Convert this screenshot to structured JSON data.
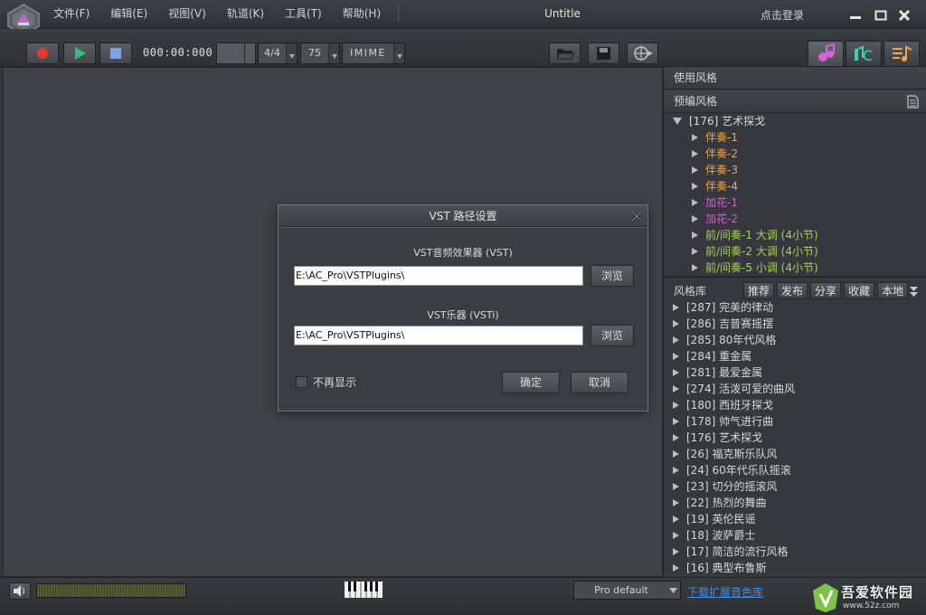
{
  "menu": [
    "文件(F)",
    "编辑(E)",
    "视图(V)",
    "轨道(K)",
    "工具(T)",
    "帮助(H)"
  ],
  "title": "Untitle",
  "login": "点击登录",
  "transport": {
    "time": "000:00:000",
    "meter": "4/4",
    "tempo": "75",
    "ime": "IMIME"
  },
  "panel": {
    "use_style": "使用风格",
    "preset_style": "预编风格",
    "preset_root": "[176] 艺术探戈",
    "preset_items": [
      {
        "label": "伴奏-1",
        "color": "#f0a64a"
      },
      {
        "label": "伴奏-2",
        "color": "#f0a64a"
      },
      {
        "label": "伴奏-3",
        "color": "#f0a64a"
      },
      {
        "label": "伴奏-4",
        "color": "#f0a64a"
      },
      {
        "label": "加花-1",
        "color": "#d959d9"
      },
      {
        "label": "加花-2",
        "color": "#d959d9"
      },
      {
        "label": "前/间奏-1 大调 (4小节)",
        "color": "#a9cf5b"
      },
      {
        "label": "前/间奏-2 大调 (4小节)",
        "color": "#a9cf5b"
      },
      {
        "label": "前/间奏-5 小调 (4小节)",
        "color": "#a9cf5b"
      }
    ],
    "library_title": "风格库",
    "library_tabs": [
      "推荐",
      "发布",
      "分享",
      "收藏",
      "本地"
    ],
    "library_items": [
      "[287] 完美的律动",
      "[286] 吉普赛摇摆",
      "[285] 80年代风格",
      "[284] 重金属",
      "[281] 最爱金属",
      "[274] 活泼可爱的曲风",
      "[180] 西班牙探戈",
      "[178] 帅气进行曲",
      "[176] 艺术探戈",
      "[26] 福克斯乐队风",
      "[24] 60年代乐队摇滚",
      "[23] 切分的摇滚风",
      "[22] 热烈的舞曲",
      "[19] 英伦民谣",
      "[18] 波萨爵士",
      "[17] 简洁的流行风格",
      "[16] 典型布鲁斯"
    ]
  },
  "dialog": {
    "title": "VST 路径设置",
    "vst_label": "VST音频效果器 (VST)",
    "vst_path": "E:\\AC_Pro\\VSTPlugins\\",
    "vsti_label": "VST乐器 (VSTi)",
    "vsti_path": "E:\\AC_Pro\\VSTPlugins\\",
    "browse": "浏览",
    "dont_show": "不再显示",
    "ok": "确定",
    "cancel": "取消"
  },
  "bottom": {
    "preset": "Pro default",
    "download_link": "下载扩展音色库",
    "watermark_top": "吾爱软件园",
    "watermark_url": "www.52z.com"
  }
}
